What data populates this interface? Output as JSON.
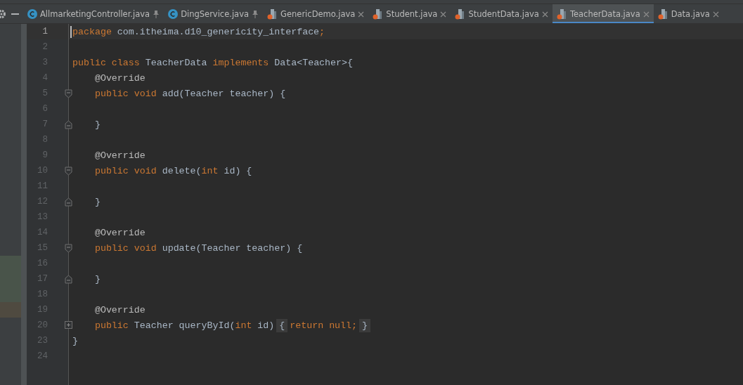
{
  "tabs": [
    {
      "label": "AllmarketingController.java",
      "kind": "class",
      "pinned": true,
      "selected": false
    },
    {
      "label": "DingService.java",
      "kind": "class",
      "pinned": true,
      "selected": false
    },
    {
      "label": "GenericDemo.java",
      "kind": "file",
      "pinned": false,
      "selected": false
    },
    {
      "label": "Student.java",
      "kind": "file",
      "pinned": false,
      "selected": false
    },
    {
      "label": "StudentData.java",
      "kind": "file",
      "pinned": false,
      "selected": false
    },
    {
      "label": "TeacherData.java",
      "kind": "file",
      "pinned": false,
      "selected": true
    },
    {
      "label": "Data.java",
      "kind": "file",
      "pinned": false,
      "selected": false
    }
  ],
  "editor": {
    "lines": [
      {
        "number": "1",
        "current": true,
        "tokens": [
          {
            "text": "package",
            "kind": "keyword"
          },
          {
            "text": " com.itheima.d10_genericity_interface",
            "kind": "plain"
          },
          {
            "text": ";",
            "kind": "keyword"
          }
        ]
      },
      {
        "number": "2",
        "current": false
      },
      {
        "number": "3",
        "current": false,
        "tokens": [
          {
            "text": "public class ",
            "kind": "keyword"
          },
          {
            "text": "TeacherData ",
            "kind": "plain"
          },
          {
            "text": "implements ",
            "kind": "keyword"
          },
          {
            "text": "Data<Teacher>{",
            "kind": "plain"
          }
        ]
      },
      {
        "number": "4",
        "current": false,
        "tokens": [
          {
            "text": "    @Override",
            "kind": "annotation"
          }
        ]
      },
      {
        "number": "5",
        "current": false,
        "fold_open": true,
        "tokens": [
          {
            "text": "    public void ",
            "kind": "keyword"
          },
          {
            "text": "add(Teacher teacher) {",
            "kind": "plain"
          }
        ]
      },
      {
        "number": "6",
        "current": false
      },
      {
        "number": "7",
        "current": false,
        "fold_close": true,
        "tokens": [
          {
            "text": "    }",
            "kind": "plain"
          }
        ]
      },
      {
        "number": "8",
        "current": false
      },
      {
        "number": "9",
        "current": false,
        "tokens": [
          {
            "text": "    @Override",
            "kind": "annotation"
          }
        ]
      },
      {
        "number": "10",
        "current": false,
        "fold_open": true,
        "tokens": [
          {
            "text": "    public void ",
            "kind": "keyword"
          },
          {
            "text": "delete(",
            "kind": "plain"
          },
          {
            "text": "int ",
            "kind": "keyword"
          },
          {
            "text": "id) {",
            "kind": "plain"
          }
        ]
      },
      {
        "number": "11",
        "current": false
      },
      {
        "number": "12",
        "current": false,
        "fold_close": true,
        "tokens": [
          {
            "text": "    }",
            "kind": "plain"
          }
        ]
      },
      {
        "number": "13",
        "current": false
      },
      {
        "number": "14",
        "current": false,
        "tokens": [
          {
            "text": "    @Override",
            "kind": "annotation"
          }
        ]
      },
      {
        "number": "15",
        "current": false,
        "fold_open": true,
        "tokens": [
          {
            "text": "    public void ",
            "kind": "keyword"
          },
          {
            "text": "update(Teacher teacher) {",
            "kind": "plain"
          }
        ]
      },
      {
        "number": "16",
        "current": false,
        "added": true
      },
      {
        "number": "17",
        "current": false,
        "fold_close": true,
        "added": true,
        "tokens": [
          {
            "text": "    }",
            "kind": "plain"
          }
        ]
      },
      {
        "number": "18",
        "current": false,
        "added": true
      },
      {
        "number": "19",
        "current": false,
        "modified": true,
        "tokens": [
          {
            "text": "    @Override",
            "kind": "annotation"
          }
        ]
      },
      {
        "number": "20",
        "current": false,
        "collapsed": true,
        "tokens": [
          {
            "text": "    public ",
            "kind": "keyword"
          },
          {
            "text": "Teacher queryById(",
            "kind": "plain"
          },
          {
            "text": "int ",
            "kind": "keyword"
          },
          {
            "text": "id)",
            "kind": "plain"
          },
          {
            "text": "{",
            "kind": "folded"
          },
          {
            "text": "return null;",
            "kind": "keyword"
          },
          {
            "text": "}",
            "kind": "folded"
          }
        ]
      },
      {
        "number": "23",
        "current": false,
        "tokens": [
          {
            "text": "}",
            "kind": "plain"
          }
        ]
      },
      {
        "number": "24",
        "current": false
      }
    ]
  }
}
